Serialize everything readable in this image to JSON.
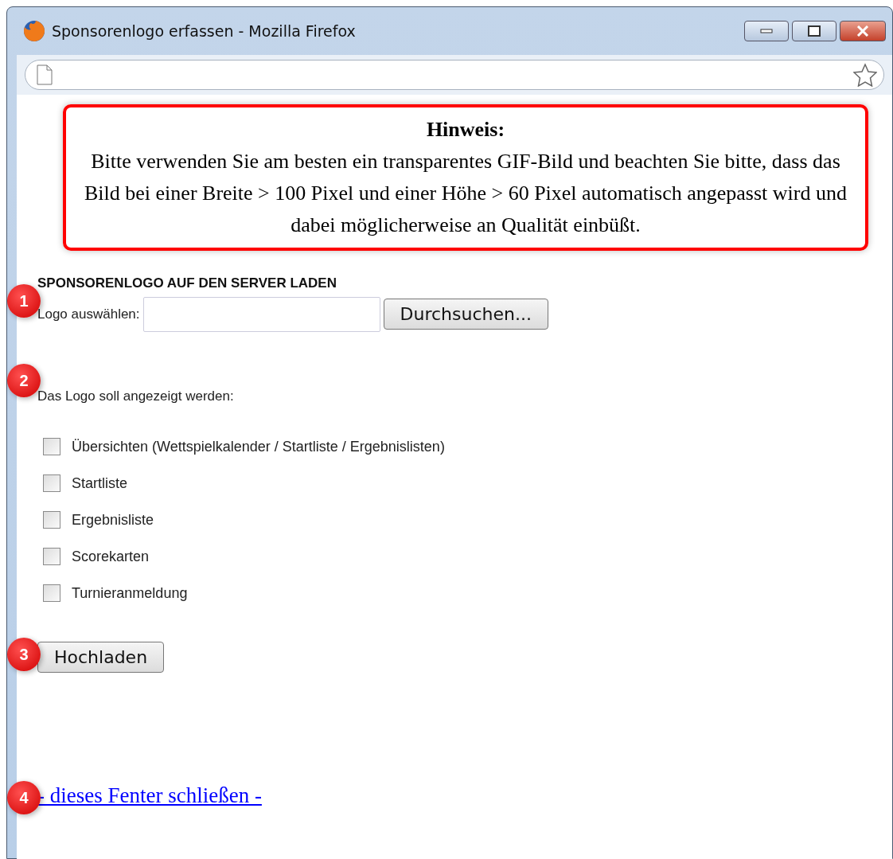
{
  "window": {
    "title": "Sponsorenlogo erfassen - Mozilla Firefox"
  },
  "notice": {
    "title": "Hinweis:",
    "text": "Bitte verwenden Sie am besten ein transparentes GIF-Bild und beachten Sie bitte, dass das Bild bei einer Breite > 100 Pixel und einer Höhe > 60 Pixel automatisch angepasst wird und dabei möglicherweise an Qualität einbüßt."
  },
  "upload": {
    "heading": "SPONSORENLOGO AUF DEN SERVER LADEN",
    "file_label": "Logo auswählen:",
    "browse_button": "Durchsuchen..."
  },
  "display": {
    "label": "Das Logo soll angezeigt werden:",
    "options": [
      {
        "label": "Übersichten (Wettspielkalender / Startliste / Ergebnislisten)",
        "checked": false
      },
      {
        "label": "Startliste",
        "checked": false
      },
      {
        "label": "Ergebnisliste",
        "checked": false
      },
      {
        "label": "Scorekarten",
        "checked": false
      },
      {
        "label": "Turnieranmeldung",
        "checked": false
      }
    ]
  },
  "submit_button": "Hochladen",
  "close_link": "- dieses Fenter schließen -",
  "step_markers": [
    "1",
    "2",
    "3",
    "4"
  ]
}
